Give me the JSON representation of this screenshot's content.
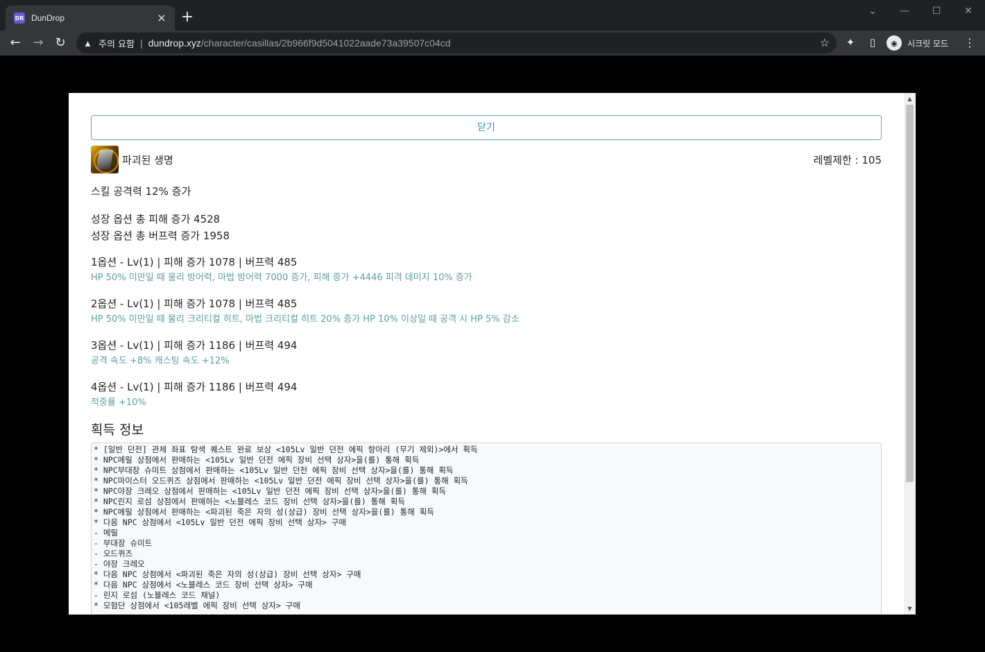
{
  "browser": {
    "tab_title": "DunDrop",
    "favicon_text": "DR",
    "new_tab": "+",
    "security_label": "주의 요함",
    "url_host": "dundrop.xyz",
    "url_path": "/character/casillas/2b966f9d5041022aade73a39507c04cd",
    "incognito_label": "시크릿 모드"
  },
  "modal": {
    "close_label": "닫기",
    "item_name": "파괴된 생명",
    "level_limit": "레벨제한 : 105",
    "effect": "스킬 공격력 12% 증가",
    "growth": [
      "성장 옵션 총 피해 증가 4528",
      "성장 옵션 총 버프력 증가 1958"
    ],
    "options": [
      {
        "head": "1옵션 - Lv(1) | 피해 증가 1078 | 버프력 485",
        "desc": "HP 50% 미만일 때 물리 방어력, 마법 방어력 7000 증가, 피해 증가 +4446 피격 데미지 10% 증가"
      },
      {
        "head": "2옵션 - Lv(1) | 피해 증가 1078 | 버프력 485",
        "desc": "HP 50% 미만일 때 물리 크리티컬 히트, 마법 크리티컬 히트 20% 증가 HP 10% 이상일 때 공격 시 HP 5% 감소"
      },
      {
        "head": "3옵션 - Lv(1) | 피해 증가 1186 | 버프력 494",
        "desc": "공격 속도 +8% 캐스팅 속도 +12%"
      },
      {
        "head": "4옵션 - Lv(1) | 피해 증가 1186 | 버프력 494",
        "desc": "적중률 +10%"
      }
    ],
    "acquire_title": "획득 정보",
    "acquire_lines": [
      "* [일반 던전] 관제 좌표 탐색 퀘스트 완료 보상 <105Lv 일반 던전 에픽 항아리 (무기 제외)>에서 획득",
      "* NPC메릴 상점에서 판매하는 <105Lv 일반 던전 에픽 장비 선택 상자>을(를) 통해 획득",
      "* NPC부대장 슈미트 상점에서 판매하는 <105Lv 일반 던전 에픽 장비 선택 상자>을(를) 통해 획득",
      "* NPC마이스터 오드퀴즈 상점에서 판매하는 <105Lv 일반 던전 에픽 장비 선택 상자>을(를) 통해 획득",
      "* NPC야장 크레오 상점에서 판매하는 <105Lv 일반 던전 에픽 장비 선택 상자>을(를) 통해 획득",
      "* NPC린지 로섬 상점에서 판매하는 <노블레스 코드 장비 선택 상자>을(를) 통해 획득",
      "* NPC메릴 상점에서 판매하는 <파괴된 죽은 자의 성(상급) 장비 선택 상자>을(를) 통해 획득",
      "* 다음 NPC 상점에서 <105Lv 일반 던전 에픽 장비 선택 상자> 구매",
      "- 메릴",
      "- 부대장 슈미트",
      "- 오드퀴즈",
      "- 야장 크레오",
      "* 다음 NPC 상점에서 <파괴된 죽은 자의 성(상급) 장비 선택 상자> 구매",
      "* 다음 NPC 상점에서 <노블레스 코드 장비 선택 상자> 구매",
      "- 린지 로섬 (노블레스 코드 채널)",
      "* 모험단 상점에서 <105레벨 에픽 장비 선택 상자> 구매"
    ]
  },
  "colors": {
    "option_desc": "#5f9ea0",
    "close_button": "#3d8fbf"
  }
}
